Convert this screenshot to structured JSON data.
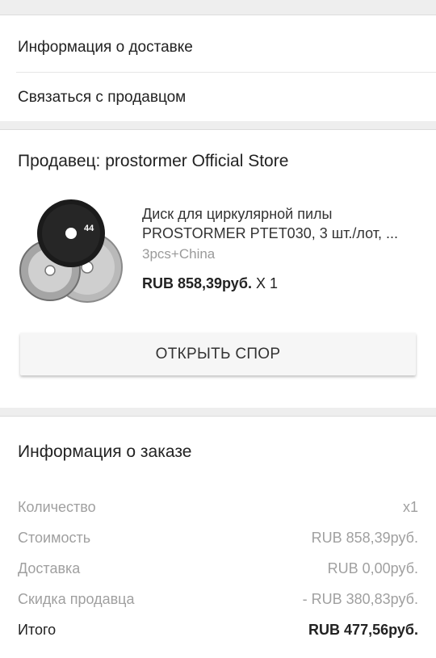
{
  "links": {
    "delivery_info": "Информация о доставке",
    "contact_seller": "Связаться с продавцом"
  },
  "seller": {
    "label": "Продавец: prostormer Official Store"
  },
  "product": {
    "title_line1": "Диск для циркулярной пилы",
    "title_line2": "PROSTORMER PTET030, 3 шт./лот, ...",
    "variant": "3pcs+China",
    "price": "RUB 858,39руб.",
    "qty": "X 1",
    "thumb_label": "44"
  },
  "dispute_button": "ОТКРЫТЬ СПОР",
  "order": {
    "title": "Информация о заказе",
    "rows": [
      {
        "label": "Количество",
        "value": "x1"
      },
      {
        "label": "Стоимость",
        "value": "RUB 858,39руб."
      },
      {
        "label": "Доставка",
        "value": "RUB 0,00руб."
      },
      {
        "label": "Скидка продавца",
        "value": "- RUB 380,83руб."
      }
    ],
    "total": {
      "label": "Итого",
      "value": "RUB 477,56руб."
    }
  }
}
